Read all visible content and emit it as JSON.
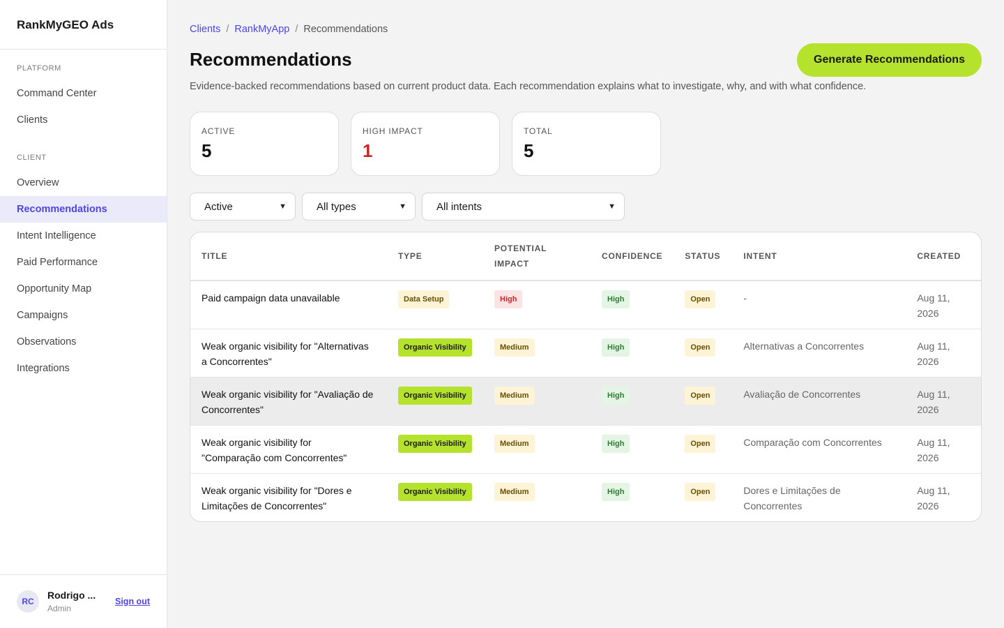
{
  "app": {
    "brand": "RankMyGEO Ads"
  },
  "sidebar": {
    "platform_label": "PLATFORM",
    "platform_items": [
      {
        "label": "Command Center"
      },
      {
        "label": "Clients"
      }
    ],
    "client_label": "CLIENT",
    "client_items": [
      {
        "label": "Overview"
      },
      {
        "label": "Recommendations"
      },
      {
        "label": "Intent Intelligence"
      },
      {
        "label": "Paid Performance"
      },
      {
        "label": "Opportunity Map"
      },
      {
        "label": "Campaigns"
      },
      {
        "label": "Observations"
      },
      {
        "label": "Integrations"
      }
    ],
    "user": {
      "initials": "RC",
      "name": "Rodrigo ...",
      "role": "Admin",
      "signout": "Sign out"
    }
  },
  "breadcrumb": {
    "items": [
      "Clients",
      "RankMyApp",
      "Recommendations"
    ],
    "sep": "/"
  },
  "page": {
    "title": "Recommendations",
    "subtitle": "Evidence-backed recommendations based on current product data. Each recommendation explains what to investigate, why, and with what confidence.",
    "generate_button": "Generate Recommendations"
  },
  "stats": [
    {
      "label": "ACTIVE",
      "value": "5"
    },
    {
      "label": "HIGH IMPACT",
      "value": "1"
    },
    {
      "label": "TOTAL",
      "value": "5"
    }
  ],
  "filters": {
    "status": "Active",
    "type": "All types",
    "intent": "All intents"
  },
  "table": {
    "headers": {
      "title": "TITLE",
      "type": "TYPE",
      "impact_1": "POTENTIAL",
      "impact_2": "IMPACT",
      "confidence": "CONFIDENCE",
      "status": "STATUS",
      "intent": "INTENT",
      "created": "CREATED"
    },
    "rows": [
      {
        "title": "Paid campaign data unavailable",
        "type": "Data Setup",
        "impact": "High",
        "confidence": "High",
        "status": "Open",
        "intent": "-",
        "created_1": "Aug 11,",
        "created_2": "2026"
      },
      {
        "title_1": "Weak organic visibility for \"Alternativas",
        "title_2": "a Concorrentes\"",
        "type": "Organic Visibility",
        "impact": "Medium",
        "confidence": "High",
        "status": "Open",
        "intent": "Alternativas a Concorrentes",
        "created_1": "Aug 11,",
        "created_2": "2026"
      },
      {
        "title_1": "Weak organic visibility for \"Avaliação de",
        "title_2": "Concorrentes\"",
        "type": "Organic Visibility",
        "impact": "Medium",
        "confidence": "High",
        "status": "Open",
        "intent": "Avaliação de Concorrentes",
        "created_1": "Aug 11,",
        "created_2": "2026"
      },
      {
        "title_1": "Weak organic visibility for",
        "title_2": "\"Comparação com Concorrentes\"",
        "type": "Organic Visibility",
        "impact": "Medium",
        "confidence": "High",
        "status": "Open",
        "intent": "Comparação com Concorrentes",
        "created_1": "Aug 11,",
        "created_2": "2026"
      },
      {
        "title_1": "Weak organic visibility for \"Dores e",
        "title_2": "Limitações de Concorrentes\"",
        "type": "Organic Visibility",
        "impact": "Medium",
        "confidence": "High",
        "status": "Open",
        "intent_1": "Dores e Limitações de",
        "intent_2": "Concorrentes",
        "created_1": "Aug 11,",
        "created_2": "2026"
      }
    ]
  },
  "colors": {
    "accent": "#4f46e5",
    "lime": "#b5e22c",
    "danger": "#c62828",
    "success": "#2e7d32"
  }
}
